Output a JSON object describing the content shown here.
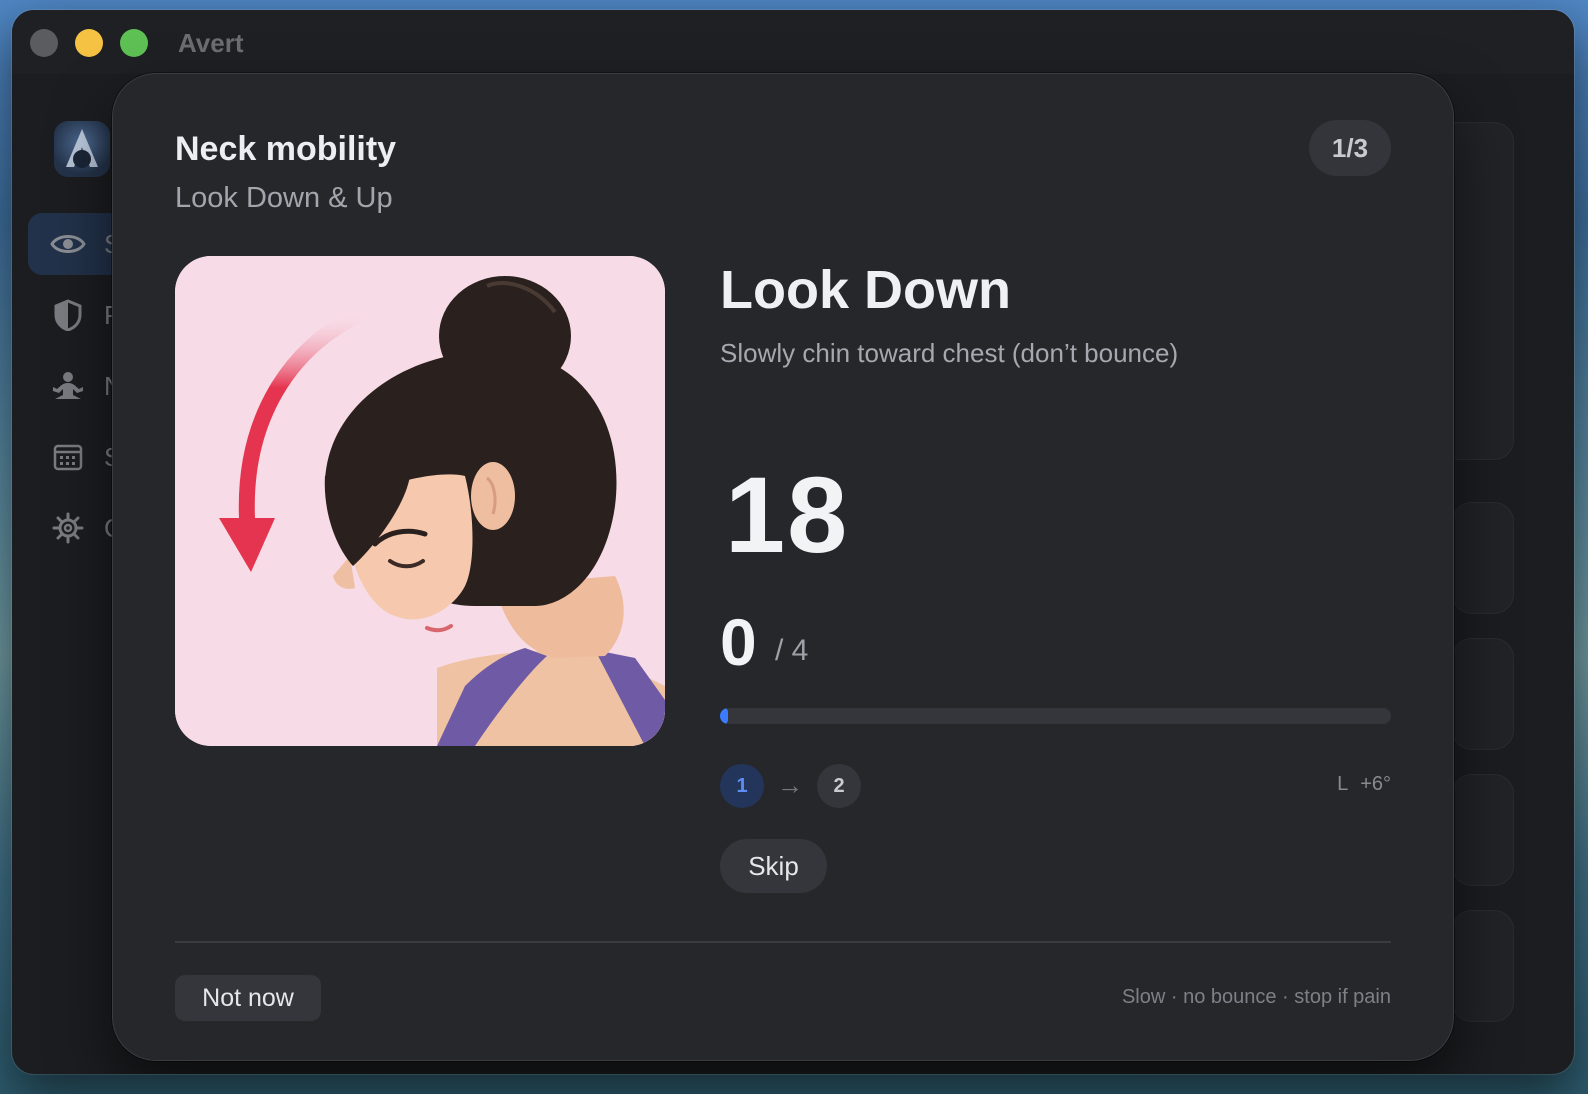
{
  "window": {
    "title": "Avert"
  },
  "sidebar": {
    "items": [
      {
        "label": "S",
        "icon": "eye-icon",
        "active": true
      },
      {
        "label": "P",
        "icon": "shield-icon",
        "active": false
      },
      {
        "label": "N",
        "icon": "meditation-icon",
        "active": false
      },
      {
        "label": "S",
        "icon": "calendar-icon",
        "active": false
      },
      {
        "label": "G",
        "icon": "gear-icon",
        "active": false
      }
    ]
  },
  "modal": {
    "title": "Neck mobility",
    "subtitle": "Look Down & Up",
    "step_indicator": "1/3",
    "exercise_name": "Look Down",
    "instruction": "Slowly chin toward chest (don’t bounce)",
    "countdown": "18",
    "reps_done": "0",
    "reps_total": "/ 4",
    "progress_fraction": 0.01,
    "phases": [
      "1",
      "2"
    ],
    "active_phase": "1",
    "angle_side": "L",
    "angle_value": "+6°",
    "skip_label": "Skip",
    "not_now_label": "Not now",
    "safety_note": "Slow · no bounce · stop if pain"
  },
  "colors": {
    "accent": "#3b7bff",
    "modal_bg": "#25272b",
    "arrow": "#e5344f",
    "illustration_bg": "#f7dbe6"
  }
}
